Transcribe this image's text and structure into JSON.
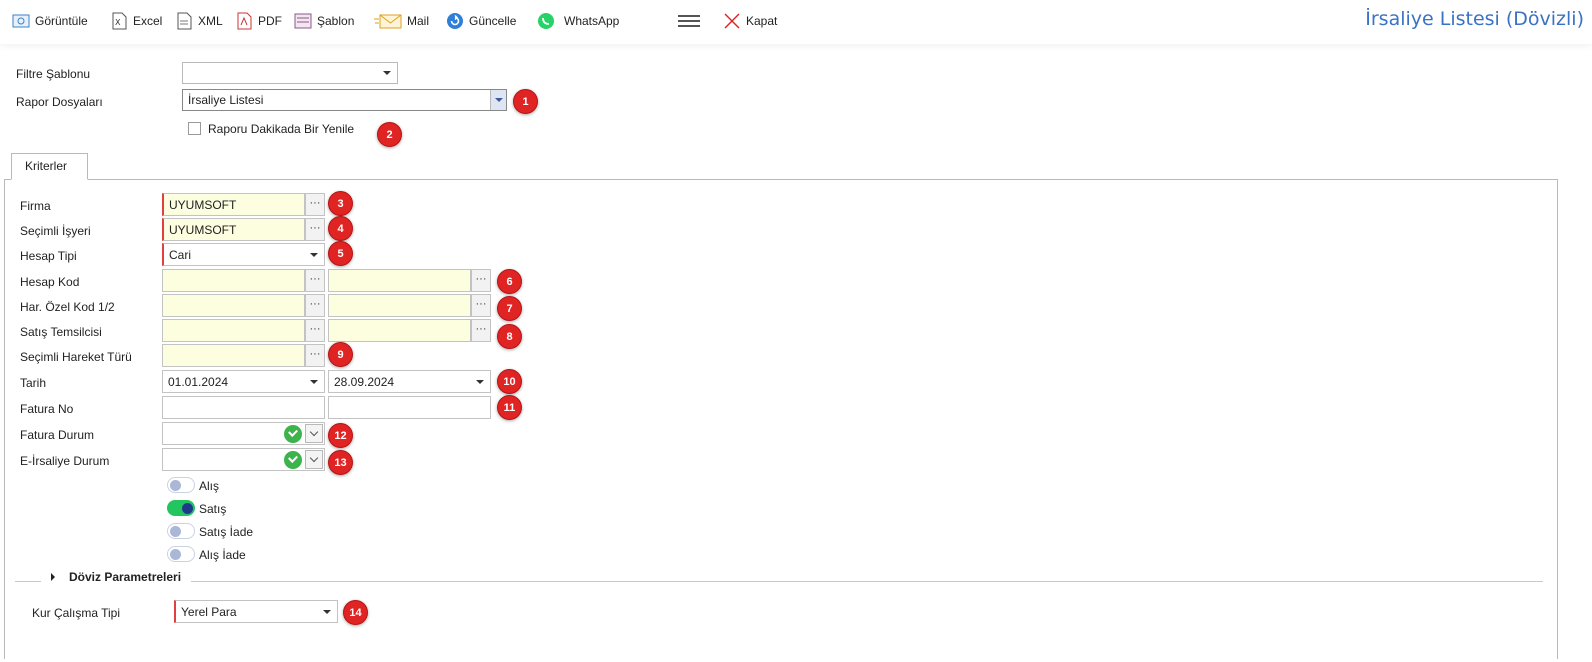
{
  "toolbar": {
    "items": [
      {
        "label": "Görüntüle",
        "icon": "view-icon"
      },
      {
        "label": "Excel",
        "icon": "excel-icon"
      },
      {
        "label": "XML",
        "icon": "xml-icon"
      },
      {
        "label": "PDF",
        "icon": "pdf-icon"
      },
      {
        "label": "Şablon",
        "icon": "template-icon"
      },
      {
        "label": "Mail",
        "icon": "mail-icon"
      },
      {
        "label": "Güncelle",
        "icon": "refresh-icon"
      },
      {
        "label": "WhatsApp",
        "icon": "whatsapp-icon"
      },
      {
        "label": "",
        "icon": "hamburger-menu-icon"
      },
      {
        "label": "Kapat",
        "icon": "close-icon"
      }
    ],
    "page_title": "İrsaliye Listesi (Dövizli)"
  },
  "header": {
    "filter_template_label": "Filtre Şablonu",
    "filter_template_value": "",
    "report_files_label": "Rapor Dosyaları",
    "report_files_value": "İrsaliye Listesi",
    "refresh_checkbox_label": "Raporu Dakikada Bir Yenile",
    "refresh_checked": false
  },
  "tabs": [
    {
      "label": "Kriterler"
    }
  ],
  "criteria": {
    "firma_label": "Firma",
    "firma_value": "UYUMSOFT",
    "isyeri_label": "Seçimli İşyeri",
    "isyeri_value": "UYUMSOFT",
    "hesap_tipi_label": "Hesap Tipi",
    "hesap_tipi_value": "Cari",
    "hesap_kod_label": "Hesap Kod",
    "ozel_kod_label": "Har. Özel Kod 1/2",
    "temsilci_label": "Satış Temsilcisi",
    "hareket_turu_label": "Seçimli Hareket Türü",
    "tarih_label": "Tarih",
    "tarih_start": "01.01.2024",
    "tarih_end": "28.09.2024",
    "fatura_no_label": "Fatura No",
    "fatura_durum_label": "Fatura Durum",
    "eirsaliye_durum_label": "E-İrsaliye Durum",
    "dots": "···",
    "toggles": [
      {
        "label": "Alış",
        "on": false
      },
      {
        "label": "Satış",
        "on": true
      },
      {
        "label": "Satış İade",
        "on": false
      },
      {
        "label": "Alış İade",
        "on": false
      }
    ]
  },
  "currency": {
    "section_title": "Döviz Parametreleri",
    "kur_label": "Kur Çalışma Tipi",
    "kur_value": "Yerel Para"
  },
  "badges": [
    "1",
    "2",
    "3",
    "4",
    "5",
    "6",
    "7",
    "8",
    "9",
    "10",
    "11",
    "12",
    "13",
    "14"
  ],
  "colors": {
    "badge": "#e02323",
    "title": "#3a72c4",
    "required": "#e04040",
    "toggle_on": "#22c55e"
  }
}
